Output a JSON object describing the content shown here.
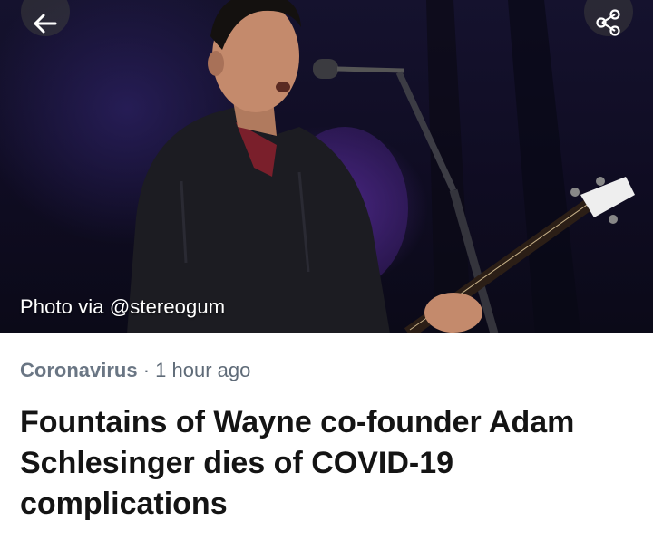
{
  "article": {
    "photo_credit": "Photo via @stereogum",
    "category": "Coronavirus",
    "separator": " · ",
    "time_ago": "1 hour ago",
    "headline": "Fountains of Wayne co-founder Adam Schlesinger dies of COVID-19 complications"
  },
  "toolbar": {
    "back_icon": "arrow-left-icon",
    "share_icon": "share-icon"
  },
  "colors": {
    "category": "#6a7684",
    "meta": "#5f6b78",
    "headline": "#141414",
    "hero_bg": "#15122e"
  }
}
